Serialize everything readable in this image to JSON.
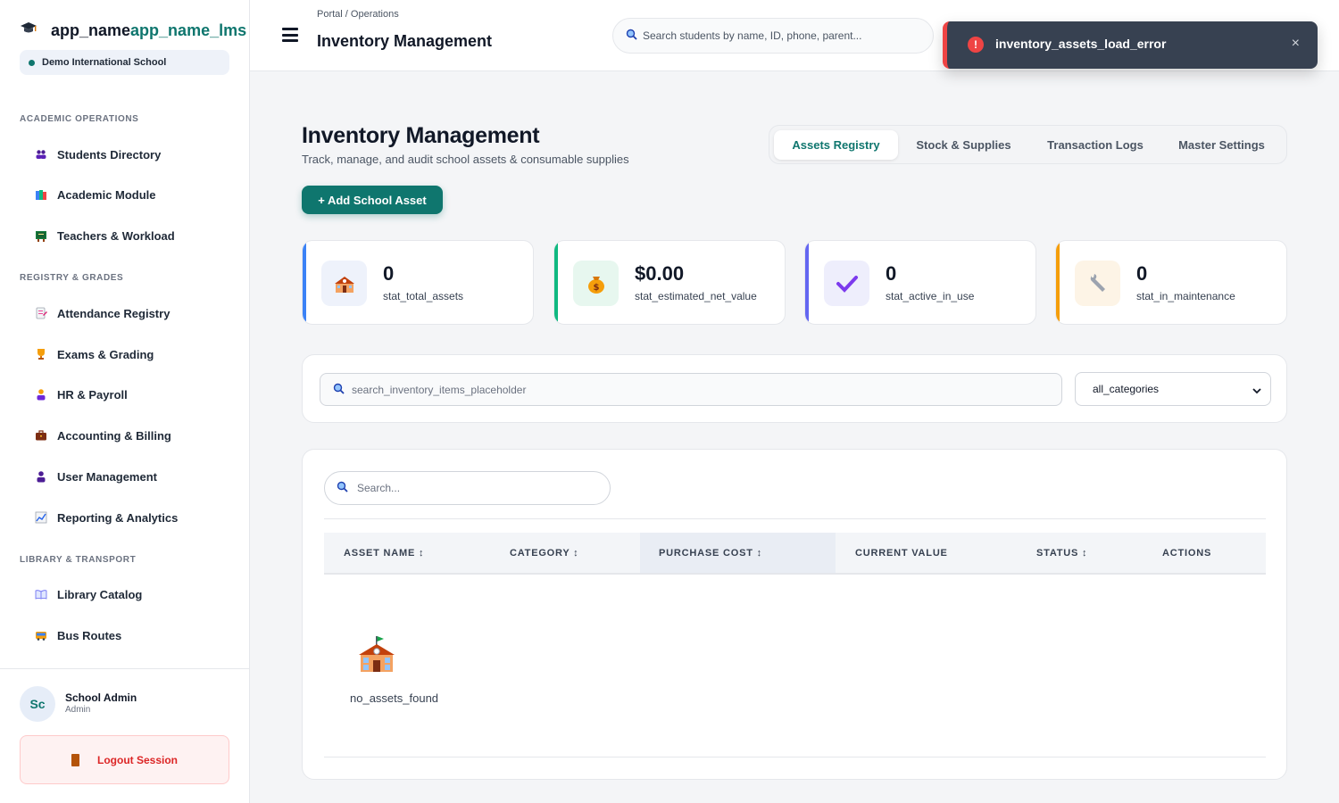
{
  "app": {
    "name_part1": "app_name",
    "name_part2": "app_name_lms",
    "school": "Demo International School"
  },
  "sidebar": {
    "sections": [
      {
        "title": "ACADEMIC OPERATIONS"
      },
      {
        "title": "REGISTRY & GRADES"
      },
      {
        "title": "LIBRARY & TRANSPORT"
      }
    ],
    "items": [
      {
        "label": "Students Directory",
        "icon": "students-icon"
      },
      {
        "label": "Academic Module",
        "icon": "books-icon"
      },
      {
        "label": "Teachers & Workload",
        "icon": "teachers-icon"
      },
      {
        "label": "Attendance Registry",
        "icon": "attendance-icon"
      },
      {
        "label": "Exams & Grading",
        "icon": "trophy-icon"
      },
      {
        "label": "HR & Payroll",
        "icon": "person-icon"
      },
      {
        "label": "Accounting & Billing",
        "icon": "briefcase-icon"
      },
      {
        "label": "User Management",
        "icon": "user-icon"
      },
      {
        "label": "Reporting & Analytics",
        "icon": "chart-icon"
      },
      {
        "label": "Library Catalog",
        "icon": "book-icon"
      },
      {
        "label": "Bus Routes",
        "icon": "bus-icon"
      }
    ],
    "user": {
      "initials": "Sc",
      "name": "School Admin",
      "role": "Admin"
    },
    "logout_label": "Logout Session"
  },
  "topbar": {
    "breadcrumb": "Portal / Operations",
    "title": "Inventory Management",
    "search_placeholder": "Search students by name, ID, phone, parent..."
  },
  "toast": {
    "message": "inventory_assets_load_error",
    "close": "×"
  },
  "main": {
    "title": "Inventory Management",
    "subtitle": "Track, manage, and audit school assets & consumable supplies",
    "tabs": [
      {
        "label": "Assets Registry",
        "active": true
      },
      {
        "label": "Stock & Supplies",
        "active": false
      },
      {
        "label": "Transaction Logs",
        "active": false
      },
      {
        "label": "Master Settings",
        "active": false
      }
    ],
    "add_button": "+  Add School Asset",
    "stats": [
      {
        "value": "0",
        "label": "stat_total_assets",
        "color": "#3b82f6",
        "icon": "school-icon"
      },
      {
        "value": "$0.00",
        "label": "stat_estimated_net_value",
        "color": "#10b981",
        "icon": "money-bag-icon"
      },
      {
        "value": "0",
        "label": "stat_active_in_use",
        "color": "#6366f1",
        "icon": "check-icon"
      },
      {
        "value": "0",
        "label": "stat_in_maintenance",
        "color": "#f59e0b",
        "icon": "wrench-icon"
      }
    ],
    "filter": {
      "search_placeholder": "search_inventory_items_placeholder",
      "category_selected": "all_categories"
    },
    "table": {
      "search_placeholder": "Search...",
      "columns": [
        "ASSET NAME ↕",
        "CATEGORY ↕",
        "PURCHASE COST ↕",
        "CURRENT VALUE",
        "STATUS ↕",
        "ACTIONS"
      ],
      "empty_text": "no_assets_found"
    }
  },
  "colors": {
    "brand": "#0f766e",
    "danger": "#ef4444"
  }
}
